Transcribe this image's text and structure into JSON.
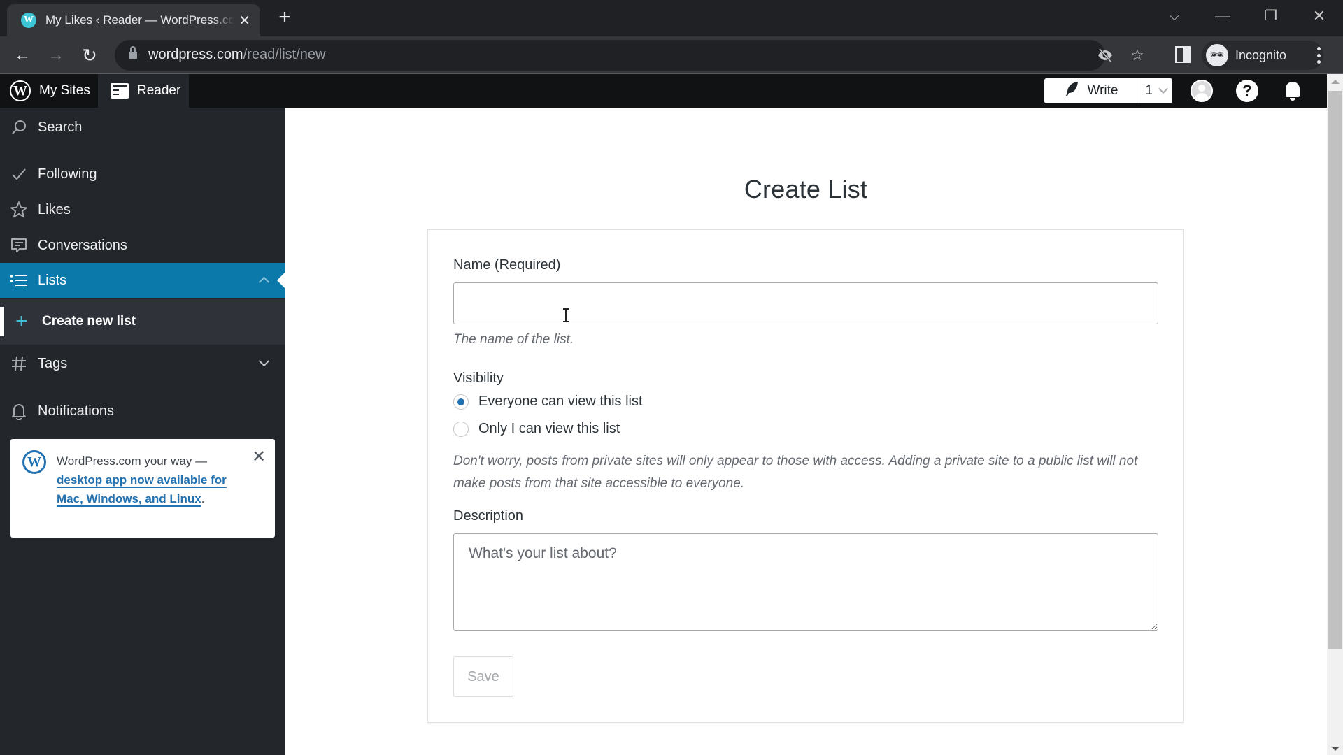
{
  "browser": {
    "tab": {
      "title": "My Likes ‹ Reader — WordPress.com",
      "favicon": "wordpress-icon"
    },
    "new_tab_label": "+",
    "window_controls": {
      "tab_search": "⌵",
      "minimize": "—",
      "restore": "❐",
      "close": "✕"
    },
    "url": {
      "host": "wordpress.com",
      "path": "/read/list/new"
    },
    "omnibox_icons": [
      "eye-slash-icon",
      "star-icon"
    ],
    "profile": {
      "label": "Incognito",
      "icon": "incognito-icon"
    }
  },
  "masterbar": {
    "my_sites": "My Sites",
    "reader": "Reader",
    "write": "Write",
    "write_count": "1",
    "help": "?"
  },
  "sidebar": {
    "items": [
      {
        "id": "search",
        "label": "Search",
        "icon": "search-icon"
      },
      {
        "id": "following",
        "label": "Following",
        "icon": "checkmark-icon"
      },
      {
        "id": "likes",
        "label": "Likes",
        "icon": "star-icon"
      },
      {
        "id": "conversations",
        "label": "Conversations",
        "icon": "comment-icon"
      },
      {
        "id": "lists",
        "label": "Lists",
        "icon": "list-icon",
        "active": true,
        "expanded": true
      },
      {
        "id": "tags",
        "label": "Tags",
        "icon": "hashtag-icon",
        "expanded": false
      },
      {
        "id": "notifications",
        "label": "Notifications",
        "icon": "bell-icon"
      }
    ],
    "lists_submenu": [
      {
        "label": "Create new list",
        "icon": "plus-icon",
        "selected": true
      }
    ],
    "promo": {
      "text": "WordPress.com your way —",
      "link_text": "desktop app now available for Mac, Windows, and Linux",
      "suffix": "."
    }
  },
  "main": {
    "title": "Create List",
    "form": {
      "name_label": "Name (Required)",
      "name_value": "",
      "name_hint": "The name of the list.",
      "visibility_label": "Visibility",
      "visibility_options": [
        {
          "label": "Everyone can view this list",
          "checked": true
        },
        {
          "label": "Only I can view this list",
          "checked": false
        }
      ],
      "visibility_note": "Don't worry, posts from private sites will only appear to those with access. Adding a private site to a public list will not make posts from that site accessible to everyone.",
      "description_label": "Description",
      "description_placeholder": "What's your list about?",
      "description_value": "",
      "save_label": "Save",
      "save_disabled": true
    }
  },
  "colors": {
    "accent": "#0b7aaa",
    "sidebar_bg": "#23272c",
    "masterbar_bg": "#101214",
    "link": "#2271b1",
    "radio_checked": "#2271b1",
    "submenu_plus": "#3ec1d8"
  }
}
